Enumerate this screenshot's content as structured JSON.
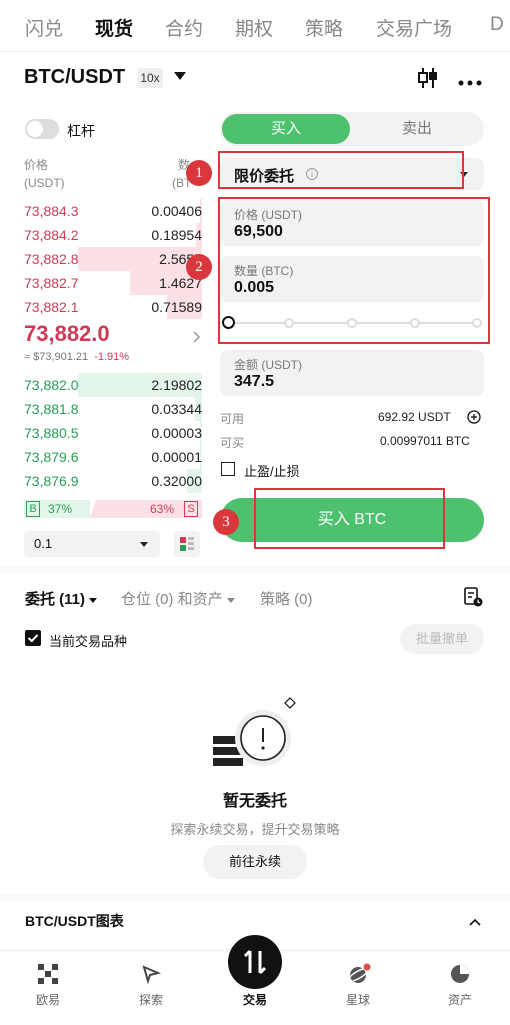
{
  "top_tabs": [
    "闪兑",
    "现货",
    "合约",
    "期权",
    "策略",
    "交易广场",
    "D"
  ],
  "pair": {
    "symbol": "BTC/USDT",
    "leverage": "10x"
  },
  "margin_toggle_label": "杠杆",
  "orderbook": {
    "price_header": "价格",
    "price_unit": "(USDT)",
    "qty_header": "数",
    "qty_unit": "(BT",
    "asks": [
      {
        "price": "73,884.3",
        "qty": "0.00406",
        "depth": 0.02
      },
      {
        "price": "73,884.2",
        "qty": "0.18954",
        "depth": 0.05
      },
      {
        "price": "73,882.8",
        "qty": "2.5657",
        "depth": 1.0
      },
      {
        "price": "73,882.7",
        "qty": "1.4627",
        "depth": 0.58
      },
      {
        "price": "73,882.1",
        "qty": "0.71589",
        "depth": 0.28
      }
    ],
    "last_price": "73,882.0",
    "index_price": "≈ $73,901.21",
    "change_pct": "-1.91%",
    "bids": [
      {
        "price": "73,882.0",
        "qty": "2.19802",
        "depth": 1.0
      },
      {
        "price": "73,881.8",
        "qty": "0.03344",
        "depth": 0.06
      },
      {
        "price": "73,880.5",
        "qty": "0.00003",
        "depth": 0.01
      },
      {
        "price": "73,879.6",
        "qty": "0.00001",
        "depth": 0.01
      },
      {
        "price": "73,876.9",
        "qty": "0.32000",
        "depth": 0.12
      }
    ],
    "buy_ratio_label": "B",
    "buy_ratio": "37%",
    "sell_ratio": "63%",
    "sell_ratio_label": "S",
    "precision": "0.1"
  },
  "order_form": {
    "buy_tab": "买入",
    "sell_tab": "卖出",
    "order_type": "限价委托",
    "price_label": "价格 (USDT)",
    "price_value": "69,500",
    "amount_label": "数量 (BTC)",
    "amount_value": "0.005",
    "total_label": "金额 (USDT)",
    "total_value": "347.5",
    "available_label": "可用",
    "available_value": "692.92 USDT",
    "can_buy_label": "可买",
    "can_buy_value": "0.00997011 BTC",
    "tpsl_label": "止盈/止损",
    "buy_button": "买入 BTC"
  },
  "annotations": {
    "badge1": "1",
    "badge2": "2",
    "badge3": "3",
    "color": "#d9373b"
  },
  "orders_section": {
    "tab_orders": "委托 (11)",
    "tab_positions": "仓位 (0) 和资产",
    "tab_strategy": "策略 (0)",
    "current_pair_filter": "当前交易品种",
    "bulk_cancel": "批量撤单",
    "empty_title": "暂无委托",
    "empty_subtitle": "探索永续交易，提升交易策略",
    "go_perpetual": "前往永续"
  },
  "chart_section": {
    "title": "BTC/USDT图表"
  },
  "bottom_nav": [
    "欧易",
    "探索",
    "交易",
    "星球",
    "资产"
  ],
  "colors": {
    "buy": "#4ec16e",
    "ask": "#d03a56",
    "bid": "#2e9d55"
  }
}
